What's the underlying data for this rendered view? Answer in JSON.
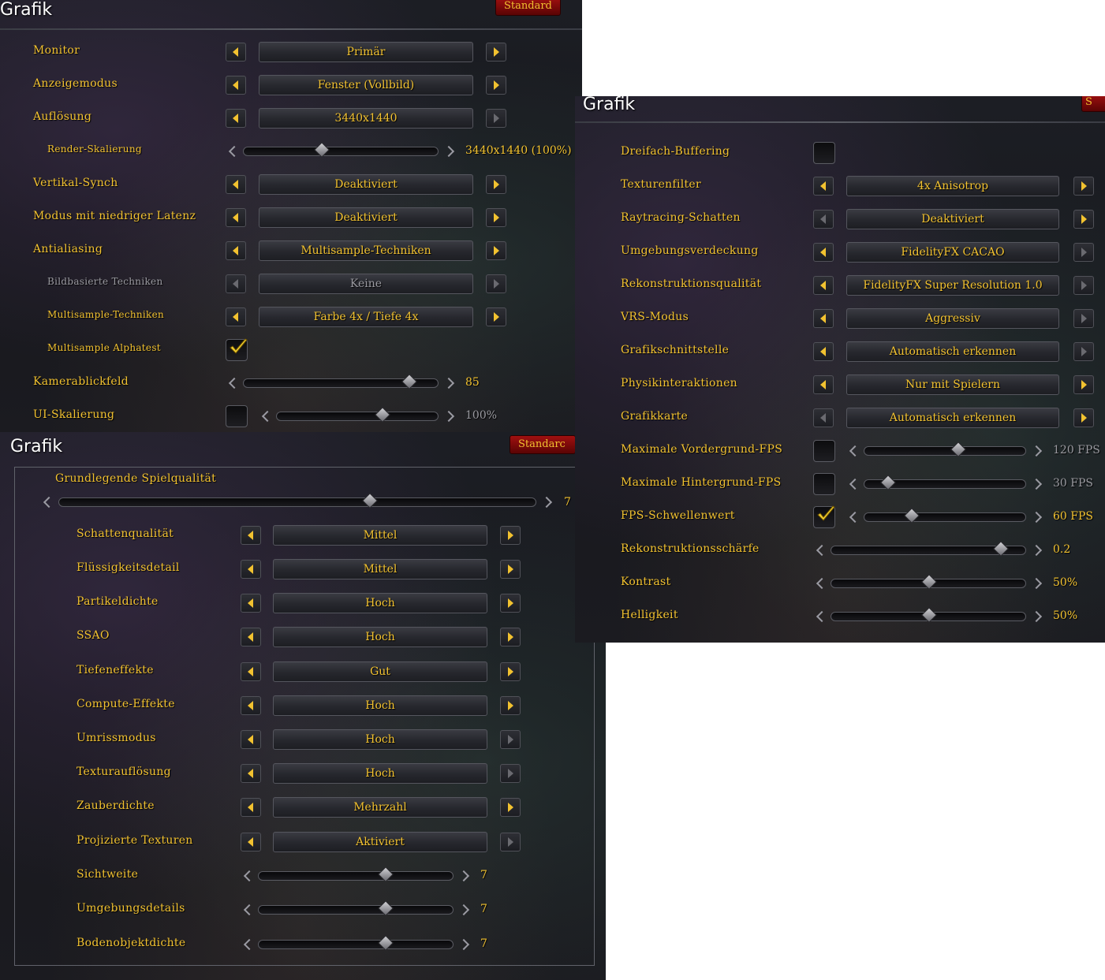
{
  "panel_top": {
    "title": "Grafik",
    "defaults_button": "Standard",
    "rows": [
      {
        "label": "Monitor",
        "value": "Primär"
      },
      {
        "label": "Anzeigemodus",
        "value": "Fenster (Vollbild)"
      },
      {
        "label": "Auflösung",
        "value": "3440x1440"
      },
      {
        "label": "Render-Skalierung",
        "value": "3440x1440 (100%)",
        "level": 0.4
      },
      {
        "label": "Vertikal-Synch",
        "value": "Deaktiviert"
      },
      {
        "label": "Modus mit niedriger Latenz",
        "value": "Deaktiviert"
      },
      {
        "label": "Antialiasing",
        "value": "Multisample-Techniken"
      },
      {
        "label": "Bildbasierte Techniken",
        "value": "Keine"
      },
      {
        "label": "Multisample-Techniken",
        "value": "Farbe 4x / Tiefe 4x"
      },
      {
        "label": "Multisample Alphatest",
        "checked": true
      },
      {
        "label": "Kamerablickfeld",
        "value": "85",
        "level": 0.85
      },
      {
        "label": "UI-Skalierung",
        "value": "100%",
        "level": 0.65,
        "checked": false
      }
    ]
  },
  "panel_right": {
    "title": "Grafik",
    "defaults_button": "S",
    "rows": [
      {
        "label": "Dreifach-Buffering",
        "checked": false
      },
      {
        "label": "Texturenfilter",
        "value": "4x Anisotrop"
      },
      {
        "label": "Raytracing-Schatten",
        "value": "Deaktiviert"
      },
      {
        "label": "Umgebungsverdeckung",
        "value": "FidelityFX CACAO"
      },
      {
        "label": "Rekonstruktionsqualität",
        "value": "FidelityFX Super Resolution 1.0"
      },
      {
        "label": "VRS-Modus",
        "value": "Aggressiv"
      },
      {
        "label": "Grafikschnittstelle",
        "value": "Automatisch erkennen"
      },
      {
        "label": "Physikinteraktionen",
        "value": "Nur mit Spielern"
      },
      {
        "label": "Grafikkarte",
        "value": "Automatisch erkennen"
      },
      {
        "label": "Maximale Vordergrund-FPS",
        "value": "120 FPS",
        "level": 0.58,
        "checked": false
      },
      {
        "label": "Maximale Hintergrund-FPS",
        "value": "30 FPS",
        "level": 0.14,
        "checked": false
      },
      {
        "label": "FPS-Schwellenwert",
        "value": "60 FPS",
        "level": 0.29,
        "checked": true
      },
      {
        "label": "Rekonstruktionsschärfe",
        "value": "0.2",
        "level": 0.87
      },
      {
        "label": "Kontrast",
        "value": "50%",
        "level": 0.5
      },
      {
        "label": "Helligkeit",
        "value": "50%",
        "level": 0.5
      }
    ]
  },
  "panel_bottom": {
    "title": "Grafik",
    "defaults_button": "Standarc",
    "quality_label": "Grundlegende Spielqualität",
    "quality_value": "7",
    "quality_level": 0.65,
    "rows": [
      {
        "label": "Schattenqualität",
        "value": "Mittel"
      },
      {
        "label": "Flüssigkeitsdetail",
        "value": "Mittel"
      },
      {
        "label": "Partikeldichte",
        "value": "Hoch"
      },
      {
        "label": "SSAO",
        "value": "Hoch"
      },
      {
        "label": "Tiefeneffekte",
        "value": "Gut"
      },
      {
        "label": "Compute-Effekte",
        "value": "Hoch"
      },
      {
        "label": "Umrissmodus",
        "value": "Hoch"
      },
      {
        "label": "Texturauflösung",
        "value": "Hoch"
      },
      {
        "label": "Zauberdichte",
        "value": "Mehrzahl"
      },
      {
        "label": "Projizierte Texturen",
        "value": "Aktiviert"
      },
      {
        "label": "Sichtweite",
        "value": "7",
        "level": 0.65
      },
      {
        "label": "Umgebungsdetails",
        "value": "7",
        "level": 0.65
      },
      {
        "label": "Bodenobjektdichte",
        "value": "7",
        "level": 0.65
      }
    ]
  },
  "colors": {
    "label_gold": "#f2c230",
    "disabled_gray": "#9a9aa0",
    "button_red": "#a01010",
    "panel_bg": "#1a1b20"
  }
}
